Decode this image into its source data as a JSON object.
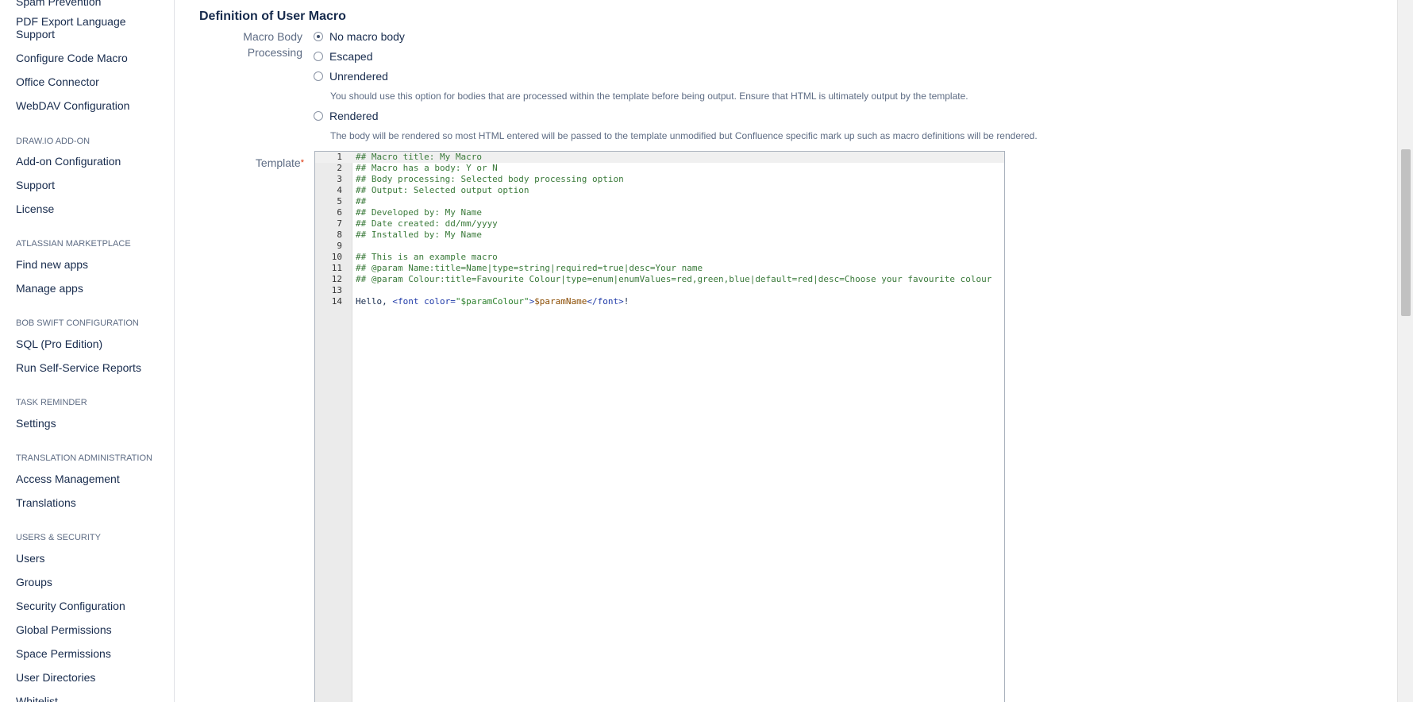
{
  "sidebar": {
    "top_partial": "Spam Prevention",
    "items_a": [
      "PDF Export Language Support",
      "Configure Code Macro",
      "Office Connector",
      "WebDAV Configuration"
    ],
    "drawio": {
      "heading": "DRAW.IO ADD-ON",
      "items": [
        "Add-on Configuration",
        "Support",
        "License"
      ]
    },
    "marketplace": {
      "heading": "ATLASSIAN MARKETPLACE",
      "items": [
        "Find new apps",
        "Manage apps"
      ]
    },
    "bobswift": {
      "heading": "BOB SWIFT CONFIGURATION",
      "items": [
        "SQL (Pro Edition)",
        "Run Self-Service Reports"
      ]
    },
    "task": {
      "heading": "TASK REMINDER",
      "items": [
        "Settings"
      ]
    },
    "translation": {
      "heading": "TRANSLATION ADMINISTRATION",
      "items": [
        "Access Management",
        "Translations"
      ]
    },
    "users": {
      "heading": "USERS & SECURITY",
      "items": [
        "Users",
        "Groups",
        "Security Configuration",
        "Global Permissions",
        "Space Permissions",
        "User Directories",
        "Whitelist"
      ]
    }
  },
  "main": {
    "section_title": "Definition of User Macro",
    "body_label_1": "Macro Body",
    "body_label_2": "Processing",
    "options": [
      "No macro body",
      "Escaped",
      "Unrendered",
      "Rendered"
    ],
    "selected_option": "No macro body",
    "unrendered_help": "You should use this option for bodies that are processed within the template before being output. Ensure that HTML is ultimately output by the template.",
    "rendered_help": "The body will be rendered so most HTML entered will be passed to the template unmodified but Confluence specific mark up such as macro definitions will be rendered.",
    "template_label": "Template",
    "required_mark": "*",
    "template_lines": [
      "## Macro title: My Macro",
      "## Macro has a body: Y or N",
      "## Body processing: Selected body processing option",
      "## Output: Selected output option",
      "##",
      "## Developed by: My Name",
      "## Date created: dd/mm/yyyy",
      "## Installed by: My Name",
      "",
      "## This is an example macro",
      "## @param Name:title=Name|type=string|required=true|desc=Your name",
      "## @param Colour:title=Favourite Colour|type=enum|enumValues=red,green,blue|default=red|desc=Choose your favourite colour",
      "",
      "Hello, <font color=\"$paramColour\">$paramName</font>!"
    ],
    "line14_parts": {
      "a": "Hello, ",
      "b": "<font color=",
      "c": "\"$paramColour\"",
      "d": ">",
      "e": "$paramName",
      "f": "</font>",
      "g": "!"
    }
  },
  "colors": {
    "link": "#172b4d",
    "muted": "#5e6c84",
    "required": "#de350b",
    "gutter": "#ebebeb"
  }
}
